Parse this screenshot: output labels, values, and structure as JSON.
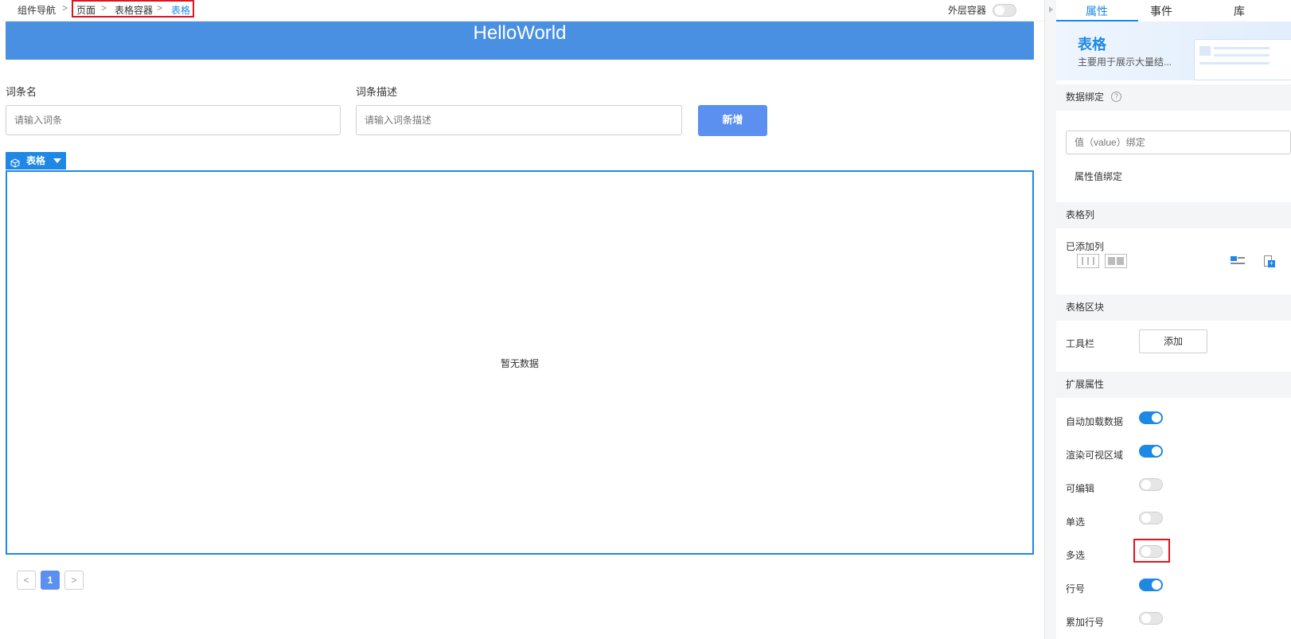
{
  "breadcrumb": {
    "root": "组件导航",
    "items": [
      "页面",
      "表格容器",
      "表格"
    ],
    "separator": ">"
  },
  "outer_container": {
    "label": "外层容器",
    "enabled": false
  },
  "canvas": {
    "banner_text": "HelloWorld",
    "form": {
      "term_name_label": "词条名",
      "term_name_placeholder": "请输入词条",
      "term_desc_label": "词条描述",
      "term_desc_placeholder": "请输入词条描述",
      "add_button": "新增"
    },
    "table": {
      "tag_label": "表格",
      "empty_text": "暂无数据"
    },
    "pagination": {
      "prev": "<",
      "current": "1",
      "next": ">"
    }
  },
  "panel": {
    "tabs": [
      "属性",
      "事件",
      "库"
    ],
    "active_tab": "属性",
    "hero": {
      "title": "表格",
      "subtitle": "主要用于展示大量结..."
    },
    "sections": {
      "data_binding": {
        "title": "数据绑定",
        "value_placeholder": "值（value）绑定",
        "attr_binding": "属性值绑定"
      },
      "table_columns": {
        "title": "表格列",
        "added_label": "已添加列"
      },
      "table_block": {
        "title": "表格区块",
        "toolbar_label": "工具栏",
        "add_button": "添加"
      },
      "extended": {
        "title": "扩展属性",
        "items": [
          {
            "label": "自动加载数据",
            "on": true
          },
          {
            "label": "渲染可视区域",
            "on": true
          },
          {
            "label": "可编辑",
            "on": false
          },
          {
            "label": "单选",
            "on": false
          },
          {
            "label": "多选",
            "on": false
          },
          {
            "label": "行号",
            "on": true
          },
          {
            "label": "累加行号",
            "on": false
          }
        ]
      }
    }
  },
  "colors": {
    "accent": "#1e88e5",
    "banner": "#4a90e2",
    "button": "#5b8ff0",
    "highlight": "#e0141e"
  }
}
